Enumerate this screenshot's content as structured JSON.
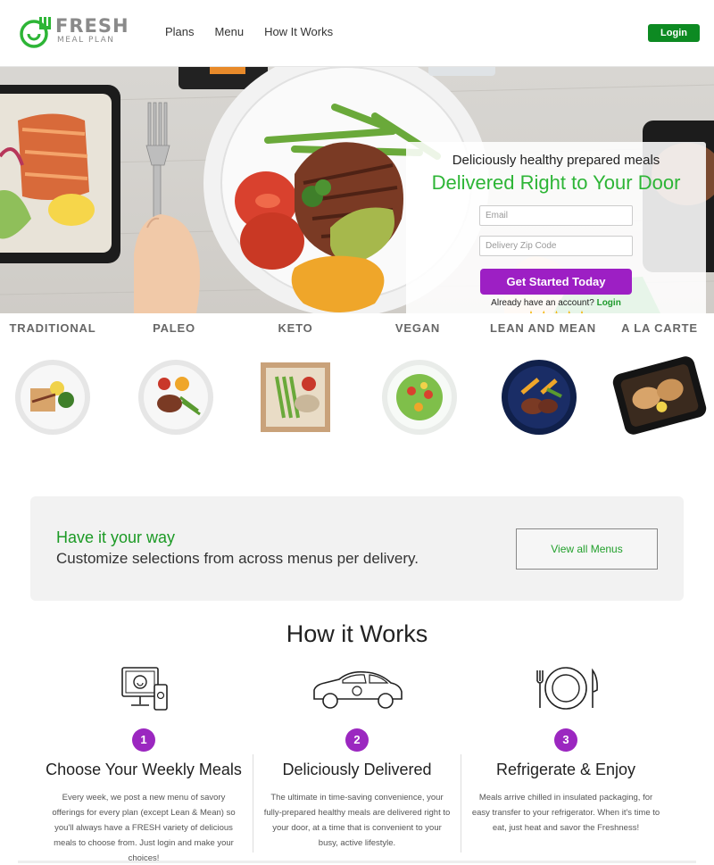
{
  "brand": {
    "name": "FRESH",
    "tagline": "MEAL PLAN",
    "green": "#2db536",
    "purple": "#9d1fc4"
  },
  "nav": {
    "items": [
      {
        "label": "Plans"
      },
      {
        "label": "Menu"
      },
      {
        "label": "How It Works"
      }
    ],
    "login_label": "Login"
  },
  "hero": {
    "subheading": "Deliciously healthy prepared meals",
    "heading": "Delivered Right to Your Door",
    "email_placeholder": "Email",
    "zip_placeholder": "Delivery Zip Code",
    "cta_label": "Get Started Today",
    "account_text": "Already have an account?",
    "account_login": "Login",
    "stars": "★★★★★"
  },
  "plans": [
    {
      "label": "TRADITIONAL"
    },
    {
      "label": "PALEO"
    },
    {
      "label": "KETO"
    },
    {
      "label": "VEGAN"
    },
    {
      "label": "LEAN AND MEAN"
    },
    {
      "label": "A LA CARTE"
    }
  ],
  "customize": {
    "heading": "Have it your way",
    "text": "Customize selections from across menus per delivery.",
    "button_label": "View all Menus"
  },
  "how": {
    "title": "How it Works",
    "steps": [
      {
        "number": "1",
        "icon": "computer-phone-icon",
        "title": "Choose Your Weekly Meals",
        "text": "Every week, we post a new menu of savory offerings for every plan (except Lean & Mean) so you'll always have a FRESH variety of delicious meals to choose from. Just login and make your choices!"
      },
      {
        "number": "2",
        "icon": "delivery-car-icon",
        "title": "Deliciously Delivered",
        "text": "The ultimate in time-saving convenience, your fully-prepared healthy meals are delivered right to your door, at a time that is convenient to your busy, active lifestyle."
      },
      {
        "number": "3",
        "icon": "plate-utensils-icon",
        "title": "Refrigerate & Enjoy",
        "text": "Meals arrive chilled in insulated packaging, for easy transfer to your refrigerator. When it's time to eat, just heat and savor the Freshness!"
      }
    ]
  }
}
